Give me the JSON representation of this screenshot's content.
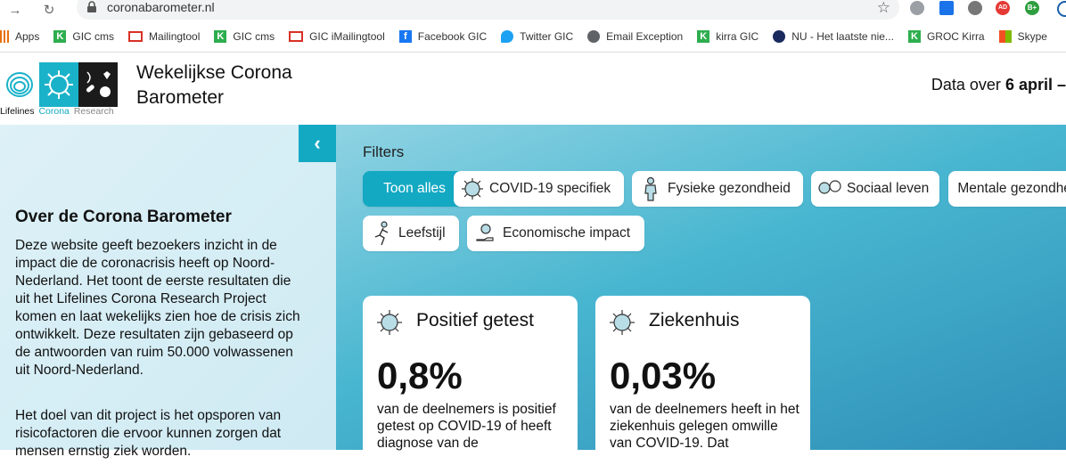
{
  "browser": {
    "url": "coronabarometer.nl",
    "bookmarks": [
      {
        "label": "Apps",
        "icon": "apps-grid-icon"
      },
      {
        "label": "GIC cms",
        "icon": "kinetic-k-icon"
      },
      {
        "label": "Mailingtool",
        "icon": "gmail-icon"
      },
      {
        "label": "GIC cms",
        "icon": "kinetic-k-icon"
      },
      {
        "label": "GIC iMailingtool",
        "icon": "gmail-icon"
      },
      {
        "label": "Facebook GIC",
        "icon": "facebook-icon"
      },
      {
        "label": "Twitter GIC",
        "icon": "twitter-icon"
      },
      {
        "label": "Email Exception",
        "icon": "globe-icon"
      },
      {
        "label": "kirra GIC",
        "icon": "kinetic-k-icon"
      },
      {
        "label": "NU - Het laatste nie...",
        "icon": "nu-icon"
      },
      {
        "label": "GROC Kirra",
        "icon": "kinetic-k-icon"
      },
      {
        "label": "Skype",
        "icon": "windows-icon"
      }
    ],
    "extension_badges": {
      "ad": "AD",
      "b": "B+"
    }
  },
  "header": {
    "logo_labels": [
      "Lifelines",
      "Corona",
      "Research"
    ],
    "title": "Wekelijkse Corona Barometer",
    "data_over_prefix": "Data over",
    "data_over_date": "6 april –"
  },
  "sidebar": {
    "about_title": "Over de Corona Barometer",
    "paragraph1": "Deze website geeft bezoekers inzicht in de impact die de coronacrisis heeft op Noord-Nederland. Het toont de eerste resultaten die uit het Lifelines Corona Research Project komen en laat wekelijks zien hoe de crisis zich ontwikkelt. Deze resultaten zijn gebaseerd op de antwoorden van ruim 50.000 volwassenen uit Noord-Nederland.",
    "paragraph2": "Het doel van dit project is het opsporen van risicofactoren die ervoor kunnen zorgen dat mensen ernstig ziek worden."
  },
  "filters": {
    "label": "Filters",
    "chips": [
      "Toon alles",
      "COVID-19 specifiek",
      "Fysieke gezondheid",
      "Sociaal leven",
      "Mentale gezondheid",
      "Leefstijl",
      "Economische impact"
    ]
  },
  "cards": [
    {
      "title": "Positief getest",
      "value": "0,8%",
      "desc": "van de deelnemers is positief getest op COVID-19 of heeft diagnose van de"
    },
    {
      "title": "Ziekenhuis",
      "value": "0,03%",
      "desc": "van de deelnemers heeft in het ziekenhuis gelegen omwille van COVID-19. Dat"
    }
  ],
  "colors": {
    "accent": "#13a9c3"
  }
}
